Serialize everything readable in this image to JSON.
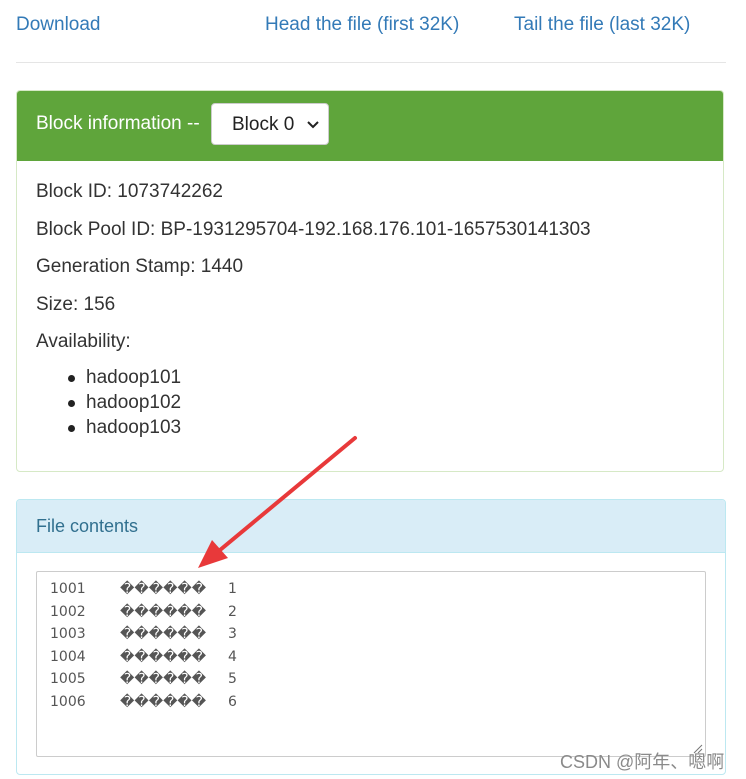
{
  "links": {
    "download": "Download",
    "head": "Head the file (first 32K)",
    "tail": "Tail the file (last 32K)"
  },
  "block_panel": {
    "title": "Block information --",
    "select_value": "Block 0",
    "block_id": "Block ID: 1073742262",
    "pool_id": "Block Pool ID: BP-1931295704-192.168.176.101-1657530141303",
    "gen_stamp": "Generation Stamp: 1440",
    "size": "Size: 156",
    "availability_label": "Availability:",
    "hosts": [
      "hadoop101",
      "hadoop102",
      "hadoop103"
    ]
  },
  "contents_panel": {
    "title": "File contents",
    "rows": [
      [
        "1001",
        "������",
        "1"
      ],
      [
        "1002",
        "������",
        "2"
      ],
      [
        "1003",
        "������",
        "3"
      ],
      [
        "1004",
        "������",
        "4"
      ],
      [
        "1005",
        "������",
        "5"
      ],
      [
        "1006",
        "������",
        "6"
      ]
    ]
  },
  "colors": {
    "link": "#337ab7",
    "success_heading": "#5fa53b",
    "info_heading": "#d9edf7",
    "arrow": "#e8393a"
  },
  "watermark": "CSDN @阿年、嗯啊"
}
